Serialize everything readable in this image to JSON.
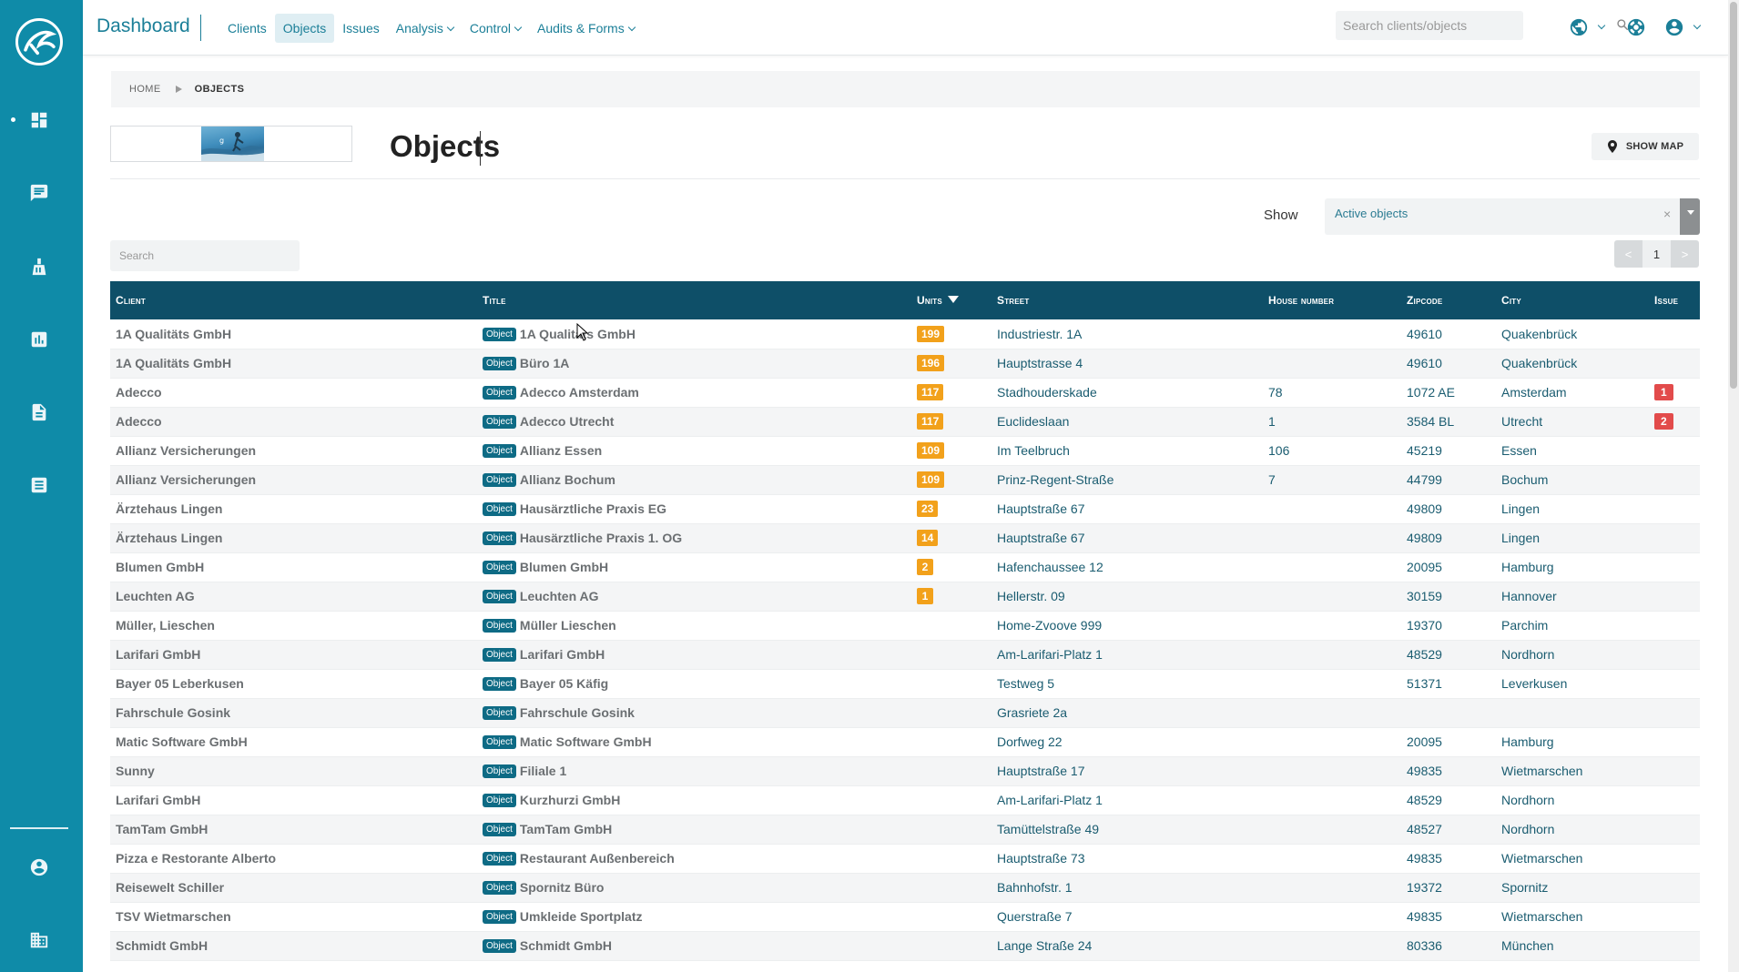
{
  "header": {
    "app_title": "Dashboard",
    "nav": [
      {
        "label": "Clients"
      },
      {
        "label": "Objects"
      },
      {
        "label": "Issues"
      },
      {
        "label": "Analysis"
      },
      {
        "label": "Control"
      },
      {
        "label": "Audits & Forms"
      }
    ],
    "search_placeholder": "Search clients/objects"
  },
  "breadcrumb": {
    "home": "HOME",
    "current": "OBJECTS"
  },
  "page": {
    "title": "Objects",
    "show_map_label": "SHOW MAP",
    "show_label": "Show",
    "show_value": "Active objects",
    "show_clear": "×",
    "table_search_placeholder": "Search",
    "pager": {
      "prev": "<",
      "current": "1",
      "next": ">"
    }
  },
  "table": {
    "columns": [
      "Client",
      "Title",
      "Units",
      "Street",
      "House number",
      "Zipcode",
      "City",
      "Issue"
    ],
    "object_badge": "Object",
    "rows": [
      {
        "client": "1A Qualitäts GmbH",
        "title": "1A Qualitäts GmbH",
        "units": "199",
        "street": "Industriestr. 1A",
        "house": "",
        "zip": "49610",
        "city": "Quakenbrück",
        "issue": ""
      },
      {
        "client": "1A Qualitäts GmbH",
        "title": "Büro 1A",
        "units": "196",
        "street": "Hauptstrasse 4",
        "house": "",
        "zip": "49610",
        "city": "Quakenbrück",
        "issue": ""
      },
      {
        "client": "Adecco",
        "title": "Adecco Amsterdam",
        "units": "117",
        "street": "Stadhouderskade",
        "house": "78",
        "zip": "1072 AE",
        "city": "Amsterdam",
        "issue": "1"
      },
      {
        "client": "Adecco",
        "title": "Adecco Utrecht",
        "units": "117",
        "street": "Euclideslaan",
        "house": "1",
        "zip": "3584 BL",
        "city": "Utrecht",
        "issue": "2"
      },
      {
        "client": "Allianz Versicherungen",
        "title": "Allianz Essen",
        "units": "109",
        "street": "Im Teelbruch",
        "house": "106",
        "zip": "45219",
        "city": "Essen",
        "issue": ""
      },
      {
        "client": "Allianz Versicherungen",
        "title": "Allianz Bochum",
        "units": "109",
        "street": "Prinz-Regent-Straße",
        "house": "7",
        "zip": "44799",
        "city": "Bochum",
        "issue": ""
      },
      {
        "client": "Ärztehaus Lingen",
        "title": "Hausärztliche Praxis EG",
        "units": "23",
        "street": "Hauptstraße 67",
        "house": "",
        "zip": "49809",
        "city": "Lingen",
        "issue": ""
      },
      {
        "client": "Ärztehaus Lingen",
        "title": "Hausärztliche Praxis 1. OG",
        "units": "14",
        "street": "Hauptstraße 67",
        "house": "",
        "zip": "49809",
        "city": "Lingen",
        "issue": ""
      },
      {
        "client": "Blumen GmbH",
        "title": "Blumen GmbH",
        "units": "2",
        "street": "Hafenchaussee 12",
        "house": "",
        "zip": "20095",
        "city": "Hamburg",
        "issue": ""
      },
      {
        "client": "Leuchten AG",
        "title": "Leuchten AG",
        "units": "1",
        "street": "Hellerstr. 09",
        "house": "",
        "zip": "30159",
        "city": "Hannover",
        "issue": ""
      },
      {
        "client": "Müller, Lieschen",
        "title": "Müller Lieschen",
        "units": "",
        "street": "Home-Zvoove 999",
        "house": "",
        "zip": "19370",
        "city": "Parchim",
        "issue": ""
      },
      {
        "client": "Larifari GmbH",
        "title": "Larifari GmbH",
        "units": "",
        "street": "Am-Larifari-Platz 1",
        "house": "",
        "zip": "48529",
        "city": "Nordhorn",
        "issue": ""
      },
      {
        "client": "Bayer 05 Leberkusen",
        "title": "Bayer 05 Käfig",
        "units": "",
        "street": "Testweg 5",
        "house": "",
        "zip": "51371",
        "city": "Leverkusen",
        "issue": ""
      },
      {
        "client": "Fahrschule Gosink",
        "title": "Fahrschule Gosink",
        "units": "",
        "street": "Grasriete 2a",
        "house": "",
        "zip": "",
        "city": "",
        "issue": ""
      },
      {
        "client": "Matic Software GmbH",
        "title": "Matic Software GmbH",
        "units": "",
        "street": "Dorfweg 22",
        "house": "",
        "zip": "20095",
        "city": "Hamburg",
        "issue": ""
      },
      {
        "client": "Sunny",
        "title": "Filiale 1",
        "units": "",
        "street": "Hauptstraße 17",
        "house": "",
        "zip": "49835",
        "city": "Wietmarschen",
        "issue": ""
      },
      {
        "client": "Larifari GmbH",
        "title": "Kurzhurzi GmbH",
        "units": "",
        "street": "Am-Larifari-Platz 1",
        "house": "",
        "zip": "48529",
        "city": "Nordhorn",
        "issue": ""
      },
      {
        "client": "TamTam GmbH",
        "title": "TamTam GmbH",
        "units": "",
        "street": "Tamüttelstraße 49",
        "house": "",
        "zip": "48527",
        "city": "Nordhorn",
        "issue": ""
      },
      {
        "client": "Pizza e Restorante Alberto",
        "title": "Restaurant Außenbereich",
        "units": "",
        "street": "Hauptstraße 73",
        "house": "",
        "zip": "49835",
        "city": "Wietmarschen",
        "issue": ""
      },
      {
        "client": "Reisewelt Schiller",
        "title": "Spornitz Büro",
        "units": "",
        "street": "Bahnhofstr. 1",
        "house": "",
        "zip": "19372",
        "city": "Spornitz",
        "issue": ""
      },
      {
        "client": "TSV Wietmarschen",
        "title": "Umkleide Sportplatz",
        "units": "",
        "street": "Querstraße 7",
        "house": "",
        "zip": "49835",
        "city": "Wietmarschen",
        "issue": ""
      },
      {
        "client": "Schmidt GmbH",
        "title": "Schmidt GmbH",
        "units": "",
        "street": "Lange Straße 24",
        "house": "",
        "zip": "80336",
        "city": "München",
        "issue": ""
      }
    ]
  },
  "colors": {
    "sidebar": "#0f8ba8",
    "accent": "#1b7f98",
    "table_header": "#0e4f68",
    "units_badge": "#f2a11b",
    "issue_badge": "#e24b4b"
  },
  "icons": {
    "sidebar": [
      "dashboard-icon",
      "chat-icon",
      "cleaning-icon",
      "analytics-icon",
      "document-icon",
      "list-icon",
      "user-icon",
      "building-icon"
    ],
    "top": [
      "globe-icon",
      "support-icon",
      "account-icon",
      "search-icon"
    ]
  }
}
